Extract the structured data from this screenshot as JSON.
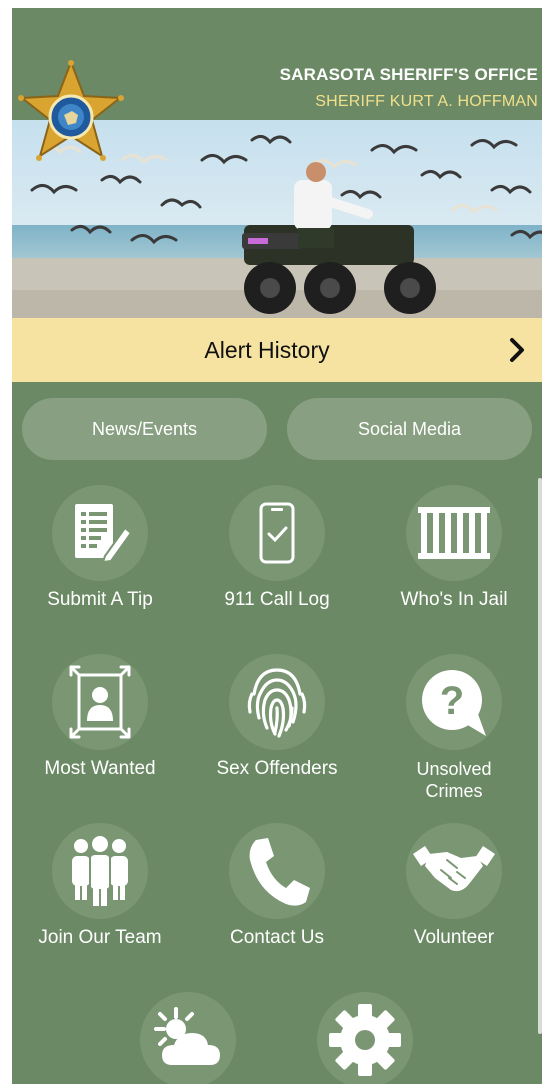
{
  "header": {
    "agency_name": "SARASOTA SHERIFF'S OFFICE",
    "sheriff_name": "SHERIFF KURT A. HOFFMAN",
    "badge_icon": "sheriff-star-badge-icon"
  },
  "alert_bar": {
    "label": "Alert History",
    "chevron_icon": "chevron-right-icon"
  },
  "top_buttons": [
    {
      "label": "News/Events"
    },
    {
      "label": "Social Media"
    }
  ],
  "grid": [
    {
      "label": "Submit A Tip",
      "icon": "tip-document-pencil-icon"
    },
    {
      "label": "911 Call Log",
      "icon": "phone-check-icon"
    },
    {
      "label": "Who's In Jail",
      "icon": "jail-bars-icon"
    },
    {
      "label": "Most Wanted",
      "icon": "wanted-poster-icon"
    },
    {
      "label": "Sex Offenders",
      "icon": "fingerprint-icon"
    },
    {
      "label": "Unsolved Crimes",
      "icon": "question-bubble-icon"
    },
    {
      "label": "Join Our Team",
      "icon": "group-people-icon"
    },
    {
      "label": "Contact Us",
      "icon": "phone-handset-icon"
    },
    {
      "label": "Volunteer",
      "icon": "handshake-icon"
    }
  ],
  "bottom_row": [
    {
      "icon": "weather-sun-cloud-icon"
    },
    {
      "icon": "gear-icon"
    }
  ],
  "colors": {
    "background": "#6b8964",
    "alert_bar": "#f6e3a2",
    "sheriff_name": "#f1e08a",
    "icon_circle": "#7a9673"
  }
}
